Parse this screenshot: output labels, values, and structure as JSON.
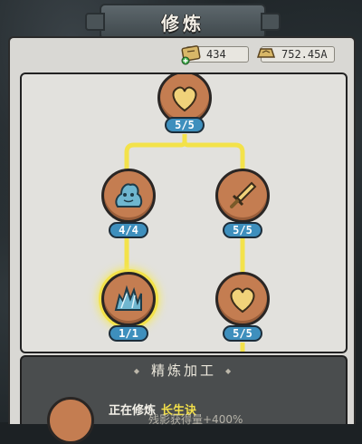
{
  "title": "修炼",
  "currencies": {
    "ticket": "434",
    "coin": "752.45A"
  },
  "nodes": [
    {
      "count": "5/5",
      "icon": "heart-icon"
    },
    {
      "count": "4/4",
      "icon": "blob-spirit-icon"
    },
    {
      "count": "5/5",
      "icon": "sword-icon"
    },
    {
      "count": "1/1",
      "icon": "crystal-icon",
      "active": true
    },
    {
      "count": "5/5",
      "icon": "heart-icon"
    }
  ],
  "craft": {
    "title": "精炼加工",
    "status_prefix": "正在修炼",
    "status_skill": "长生诀",
    "bonus": "残影获得量+400%"
  },
  "colors": {
    "node_fill": "#c47d51",
    "badge": "#3e8fbd",
    "path_line": "#f3e24a",
    "highlight_text": "#f2df4a"
  }
}
